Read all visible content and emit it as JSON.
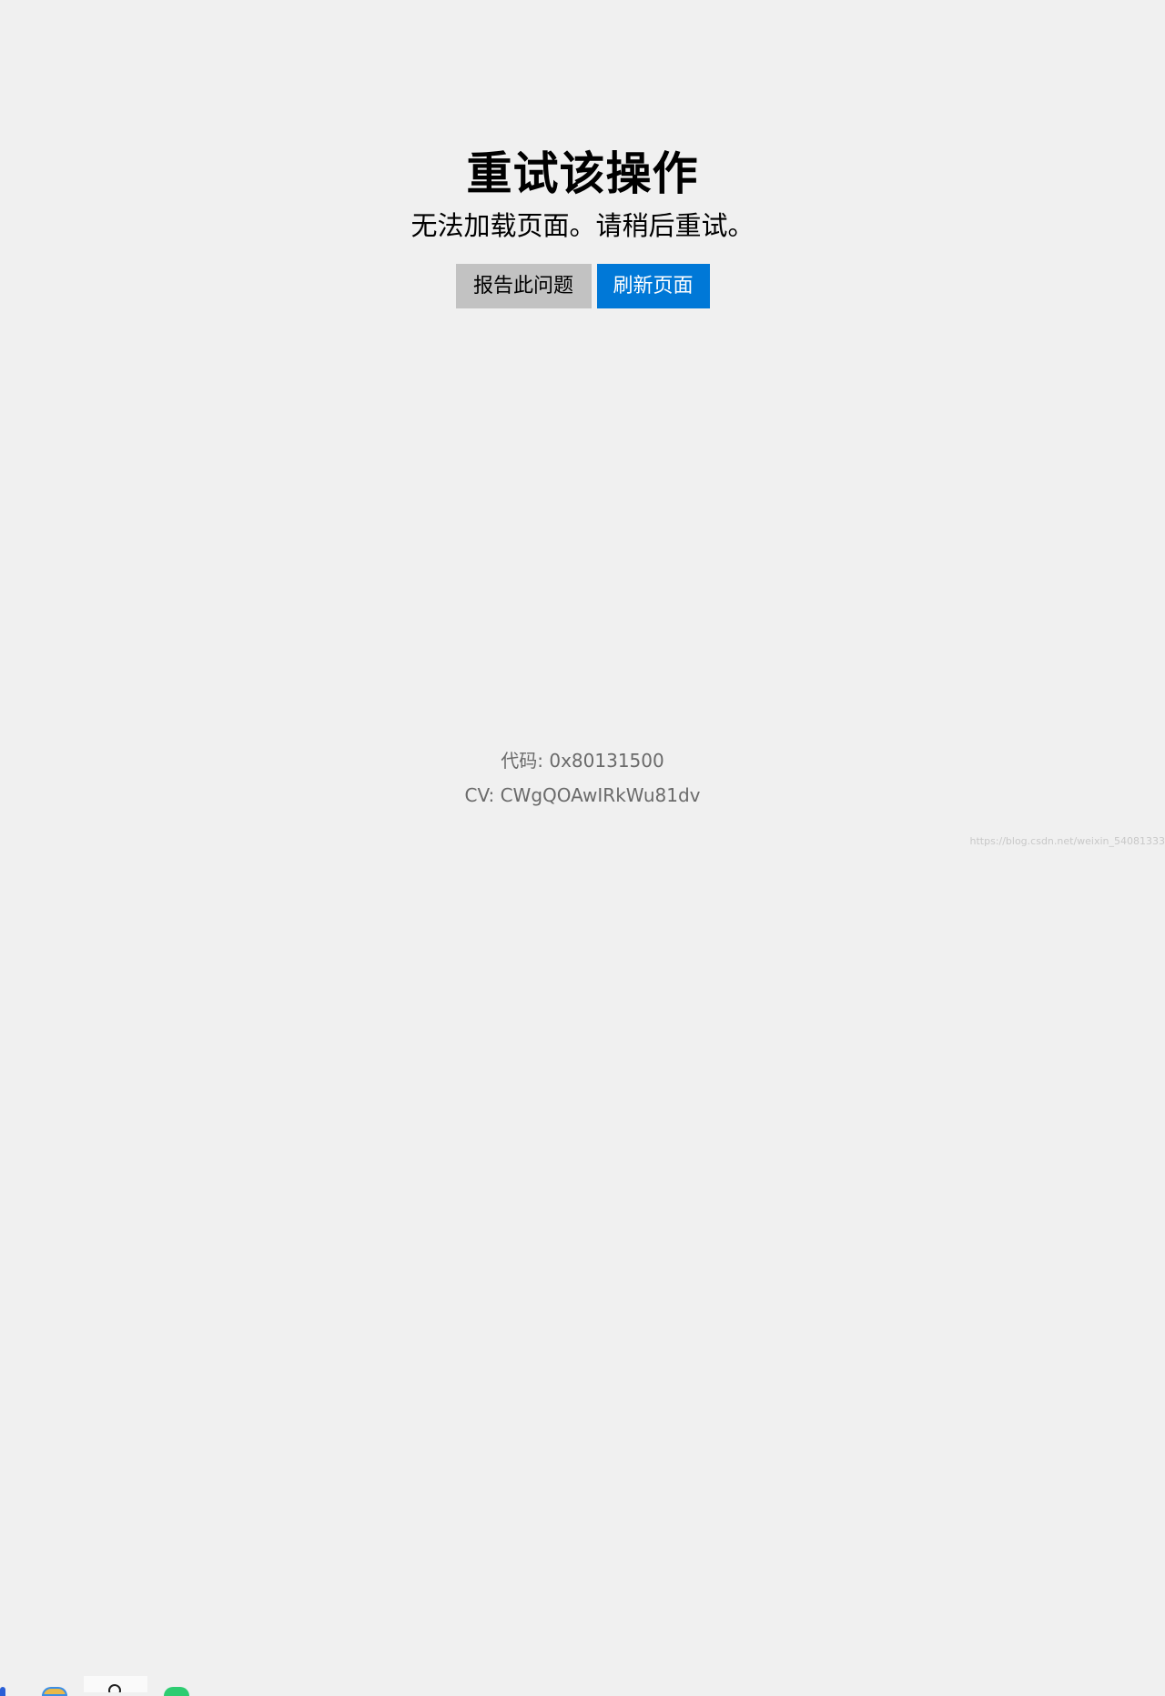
{
  "error_page": {
    "title": "重试该操作",
    "message": "无法加载页面。请稍后重试。",
    "report_button_label": "报告此问题",
    "refresh_button_label": "刷新页面"
  },
  "footer": {
    "code_text": "代码: 0x80131500",
    "cv_text": "CV: CWgQOAwIRkWu81dv"
  },
  "watermark": {
    "text": "https://blog.csdn.net/weixin_54081333"
  },
  "taskbar": {
    "icons": [
      "app-icon",
      "folder-icon",
      "pin-icon",
      "chat-icon"
    ]
  },
  "colors": {
    "background": "#f0f0f0",
    "accent": "#0078d7",
    "secondary_button": "#c2c2c2"
  }
}
